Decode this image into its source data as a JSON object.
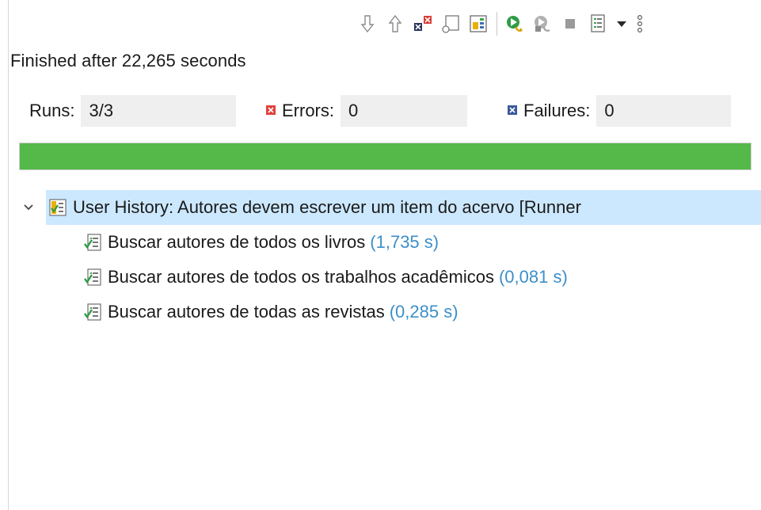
{
  "status": {
    "text": "Finished after 22,265 seconds"
  },
  "counters": {
    "runs_label": "Runs:",
    "runs_value": "3/3",
    "errors_label": "Errors:",
    "errors_value": "0",
    "failures_label": "Failures:",
    "failures_value": "0"
  },
  "progress": {
    "fraction": 1.0,
    "color": "#54b948"
  },
  "toolbar": {
    "icons": [
      "next-failure-icon",
      "previous-failure-icon",
      "show-failures-only-icon",
      "scroll-lock-icon",
      "show-skipped-icon",
      "rerun-icon",
      "rerun-failed-first-icon",
      "stop-icon",
      "history-icon",
      "view-menu-icon",
      "more-icon"
    ]
  },
  "tree": {
    "root": {
      "label": "User History: Autores devem escrever um item do acervo [Runner"
    },
    "children": [
      {
        "label": "Buscar autores de todos os livros",
        "time": "(1,735 s)"
      },
      {
        "label": "Buscar autores de todos os trabalhos acadêmicos",
        "time": "(0,081 s)"
      },
      {
        "label": "Buscar autores de todas as revistas",
        "time": "(0,285 s)"
      }
    ]
  },
  "colors": {
    "selection": "#cce8ff",
    "time_text": "#3c8fc9",
    "error_red": "#e0403a",
    "failure_blue": "#3a5a9a"
  }
}
